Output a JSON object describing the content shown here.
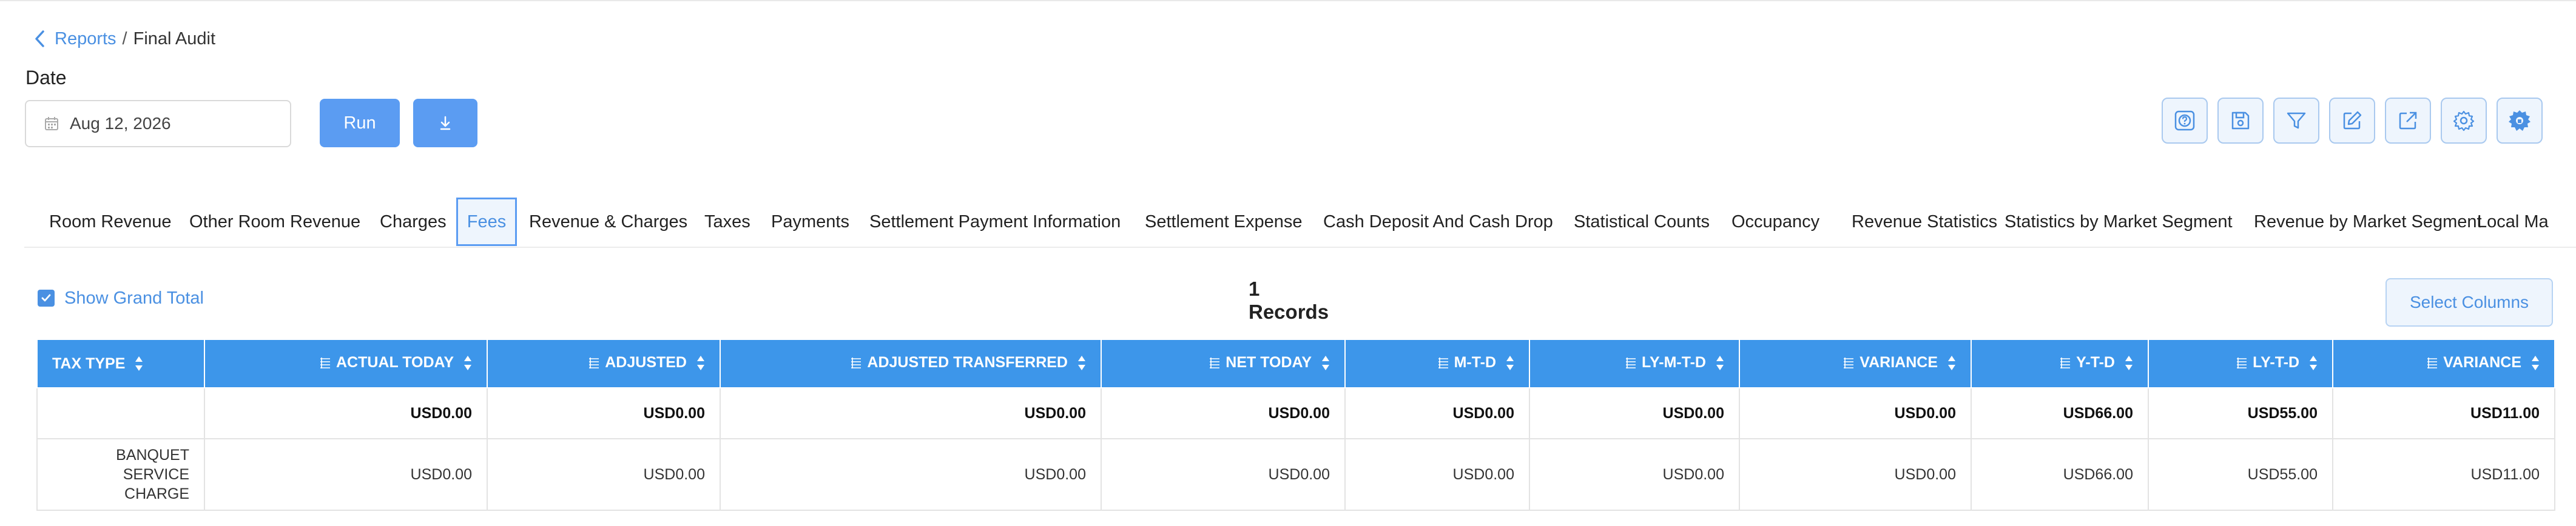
{
  "breadcrumb": {
    "parent": "Reports",
    "separator": "/",
    "current": "Final Audit"
  },
  "filters": {
    "date_label": "Date",
    "date_value": "Aug 12, 2026",
    "run_label": "Run"
  },
  "toolbar_icons": [
    "help-icon",
    "save-icon",
    "filter-icon",
    "edit-icon",
    "export-icon",
    "settings-icon",
    "gear-settings-icon"
  ],
  "tabs": [
    {
      "label": "Room Revenue"
    },
    {
      "label": "Other Room Revenue"
    },
    {
      "label": "Charges"
    },
    {
      "label": "Fees",
      "active": true
    },
    {
      "label": "Revenue & Charges"
    },
    {
      "label": "Taxes"
    },
    {
      "label": "Payments"
    },
    {
      "label": "Settlement Payment Information"
    },
    {
      "label": "Settlement Expense"
    },
    {
      "label": "Cash Deposit And Cash Drop"
    },
    {
      "label": "Statistical Counts"
    },
    {
      "label": "Occupancy"
    },
    {
      "label": "Revenue Statistics"
    },
    {
      "label": "Statistics by Market Segment"
    },
    {
      "label": "Revenue by Market Segment"
    },
    {
      "label": "Local Ma"
    }
  ],
  "grand_total": {
    "label": "Show Grand Total",
    "checked": true
  },
  "records": "1 Records",
  "select_columns": "Select Columns",
  "table": {
    "columns": [
      "TAX TYPE",
      "ACTUAL TODAY",
      "ADJUSTED",
      "ADJUSTED TRANSFERRED",
      "NET TODAY",
      "M-T-D",
      "LY-M-T-D",
      "VARIANCE",
      "Y-T-D",
      "LY-T-D",
      "VARIANCE"
    ],
    "total_row": [
      "",
      "USD0.00",
      "USD0.00",
      "USD0.00",
      "USD0.00",
      "USD0.00",
      "USD0.00",
      "USD0.00",
      "USD66.00",
      "USD55.00",
      "USD11.00"
    ],
    "rows": [
      {
        "tax_type_line1": "BANQUET SERVICE",
        "tax_type_line2": "CHARGE",
        "values": [
          "USD0.00",
          "USD0.00",
          "USD0.00",
          "USD0.00",
          "USD0.00",
          "USD0.00",
          "USD0.00",
          "USD66.00",
          "USD55.00",
          "USD11.00"
        ]
      }
    ]
  },
  "colors": {
    "accent": "#4a90e2",
    "header_bg": "#3d96ea",
    "button_bg": "#5b9cf2"
  }
}
